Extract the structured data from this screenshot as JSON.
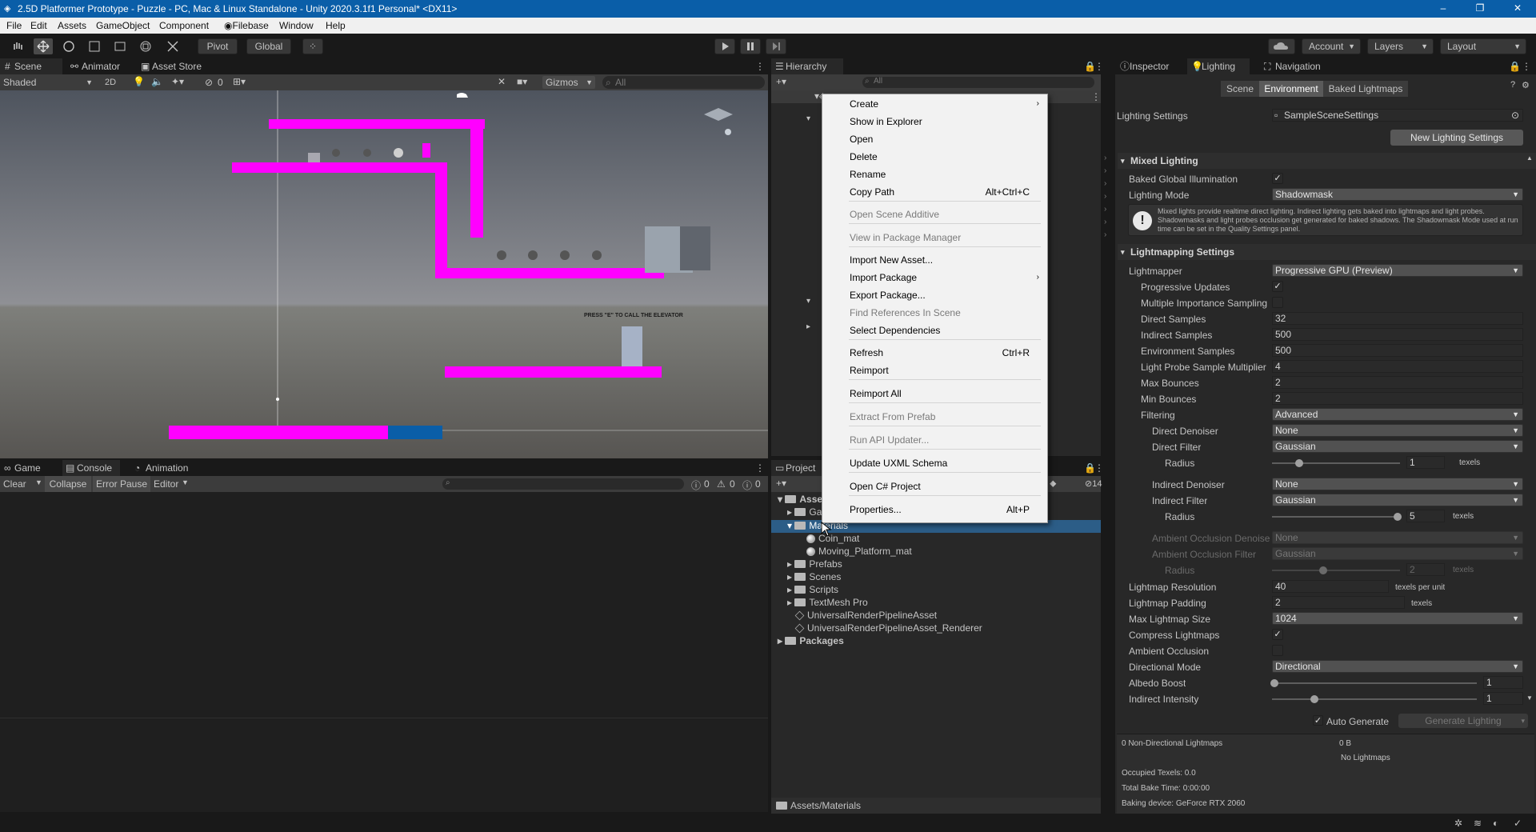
{
  "window": {
    "title": "2.5D Platformer Prototype - Puzzle - PC, Mac & Linux Standalone - Unity 2020.3.1f1 Personal* <DX11>"
  },
  "menubar": [
    "File",
    "Edit",
    "Assets",
    "GameObject",
    "Component",
    "Filebase",
    "Window",
    "Help"
  ],
  "toolbar": {
    "pivot": "Pivot",
    "global": "Global",
    "account": "Account",
    "layers": "Layers",
    "layout": "Layout"
  },
  "scene": {
    "tabs": [
      "Scene",
      "Animator",
      "Asset Store"
    ],
    "shading": "Shaded",
    "mode2d": "2D",
    "hidden_count": "0",
    "gizmos": "Gizmos",
    "search_placeholder": "All",
    "world_text": "PRESS \"E\" TO CALL THE ELEVATOR"
  },
  "bottom": {
    "tabs": [
      "Game",
      "Console",
      "Animation"
    ],
    "clear": "Clear",
    "collapse": "Collapse",
    "error_pause": "Error Pause",
    "editor": "Editor",
    "log_count": "0",
    "warn_count": "0",
    "error_count": "0"
  },
  "hierarchy": {
    "tab": "Hierarchy",
    "search_placeholder": "All"
  },
  "project": {
    "tab": "Project",
    "hidden_count": "14",
    "path": "Assets/Materials",
    "items": [
      {
        "label": "Assets",
        "type": "folder"
      },
      {
        "label": "Ga",
        "type": "folder"
      },
      {
        "label": "Materials",
        "type": "folder"
      },
      {
        "label": "Coin_mat",
        "type": "material"
      },
      {
        "label": "Moving_Platform_mat",
        "type": "material"
      },
      {
        "label": "Prefabs",
        "type": "folder"
      },
      {
        "label": "Scenes",
        "type": "folder"
      },
      {
        "label": "Scripts",
        "type": "folder"
      },
      {
        "label": "TextMesh Pro",
        "type": "folder"
      },
      {
        "label": "UniversalRenderPipelineAsset",
        "type": "asset"
      },
      {
        "label": "UniversalRenderPipelineAsset_Renderer",
        "type": "asset"
      },
      {
        "label": "Packages",
        "type": "folder"
      }
    ]
  },
  "context_menu": {
    "items": [
      {
        "label": "Create",
        "shortcut": "",
        "disabled": false,
        "submenu": true
      },
      {
        "label": "Show in Explorer",
        "shortcut": "",
        "disabled": false
      },
      {
        "label": "Open",
        "shortcut": "",
        "disabled": false
      },
      {
        "label": "Delete",
        "shortcut": "",
        "disabled": false
      },
      {
        "label": "Rename",
        "shortcut": "",
        "disabled": false
      },
      {
        "label": "Copy Path",
        "shortcut": "Alt+Ctrl+C",
        "disabled": false
      },
      {
        "label": "Open Scene Additive",
        "shortcut": "",
        "disabled": true
      },
      {
        "label": "View in Package Manager",
        "shortcut": "",
        "disabled": true
      },
      {
        "label": "Import New Asset...",
        "shortcut": "",
        "disabled": false
      },
      {
        "label": "Import Package",
        "shortcut": "",
        "disabled": false,
        "submenu": true
      },
      {
        "label": "Export Package...",
        "shortcut": "",
        "disabled": false
      },
      {
        "label": "Find References In Scene",
        "shortcut": "",
        "disabled": true
      },
      {
        "label": "Select Dependencies",
        "shortcut": "",
        "disabled": false
      },
      {
        "label": "Refresh",
        "shortcut": "Ctrl+R",
        "disabled": false
      },
      {
        "label": "Reimport",
        "shortcut": "",
        "disabled": false
      },
      {
        "label": "Reimport All",
        "shortcut": "",
        "disabled": false
      },
      {
        "label": "Extract From Prefab",
        "shortcut": "",
        "disabled": true
      },
      {
        "label": "Run API Updater...",
        "shortcut": "",
        "disabled": true
      },
      {
        "label": "Update UXML Schema",
        "shortcut": "",
        "disabled": false
      },
      {
        "label": "Open C# Project",
        "shortcut": "",
        "disabled": false
      },
      {
        "label": "Properties...",
        "shortcut": "Alt+P",
        "disabled": false
      }
    ]
  },
  "inspector": {
    "tabs": [
      "Inspector",
      "Lighting",
      "Navigation"
    ],
    "subtabs": [
      "Scene",
      "Environment",
      "Baked Lightmaps"
    ],
    "lighting_settings_label": "Lighting Settings",
    "lighting_settings_value": "SampleSceneSettings",
    "new_button": "New Lighting Settings",
    "mixed_header": "Mixed Lighting",
    "baked_gi": "Baked Global Illumination",
    "lighting_mode": "Lighting Mode",
    "lighting_mode_value": "Shadowmask",
    "help_text": "Mixed lights provide realtime direct lighting. Indirect lighting gets baked into lightmaps and light probes. Shadowmasks and light probes occlusion get generated for baked shadows. The Shadowmask Mode used at run time can be set in the Quality Settings panel.",
    "lm_header": "Lightmapping Settings",
    "rows": {
      "lightmapper": [
        "Lightmapper",
        "Progressive GPU (Preview)"
      ],
      "prog_updates": "Progressive Updates",
      "mis": "Multiple Importance Sampling",
      "direct_samples": [
        "Direct Samples",
        "32"
      ],
      "indirect_samples": [
        "Indirect Samples",
        "500"
      ],
      "env_samples": [
        "Environment Samples",
        "500"
      ],
      "lp_mult": [
        "Light Probe Sample Multiplier",
        "4"
      ],
      "max_bounces": [
        "Max Bounces",
        "2"
      ],
      "min_bounces": [
        "Min Bounces",
        "2"
      ],
      "filtering": [
        "Filtering",
        "Advanced"
      ],
      "direct_denoiser": [
        "Direct Denoiser",
        "None"
      ],
      "direct_filter": [
        "Direct Filter",
        "Gaussian"
      ],
      "radius1": [
        "Radius",
        "1",
        "texels"
      ],
      "indirect_denoiser": [
        "Indirect Denoiser",
        "None"
      ],
      "indirect_filter": [
        "Indirect Filter",
        "Gaussian"
      ],
      "radius2": [
        "Radius",
        "5",
        "texels"
      ],
      "ao_denoiser": [
        "Ambient Occlusion Denoiser",
        "None"
      ],
      "ao_filter": [
        "Ambient Occlusion Filter",
        "Gaussian"
      ],
      "radius3": [
        "Radius",
        "2",
        "texels"
      ],
      "lm_res": [
        "Lightmap Resolution",
        "40",
        "texels per unit"
      ],
      "lm_pad": [
        "Lightmap Padding",
        "2",
        "texels"
      ],
      "max_lm": [
        "Max Lightmap Size",
        "1024"
      ],
      "compress": "Compress Lightmaps",
      "ao": "Ambient Occlusion",
      "dir_mode": [
        "Directional Mode",
        "Directional"
      ],
      "albedo": [
        "Albedo Boost",
        "1"
      ],
      "ind_int": [
        "Indirect Intensity",
        "1"
      ]
    },
    "auto_generate": "Auto Generate",
    "generate_button": "Generate Lighting",
    "stats": {
      "non_dir": "0 Non-Directional Lightmaps",
      "size": "0 B",
      "none": "No Lightmaps",
      "occupied": "Occupied Texels: 0.0",
      "bake_time": "Total Bake Time: 0:00:00",
      "device": "Baking device: GeForce RTX 2060"
    }
  },
  "colors": {
    "accent": "#0a5ea8",
    "magenta": "#ff00ff",
    "selection": "#2c5d87"
  }
}
